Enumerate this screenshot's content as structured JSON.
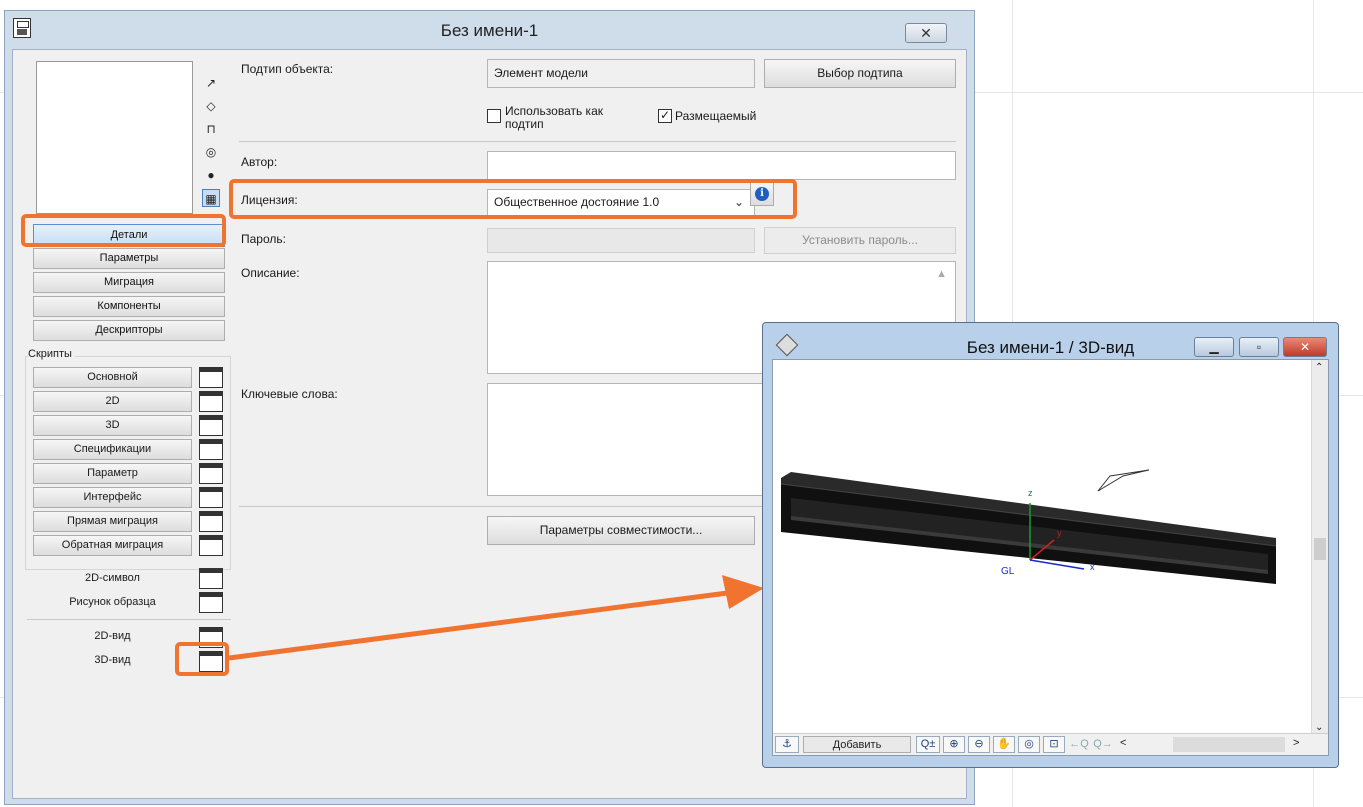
{
  "main_window": {
    "title": "Без имени-1",
    "close_label": "✕"
  },
  "view_icons": [
    "↗",
    "◇",
    "⊓",
    "◎",
    "●",
    "▦"
  ],
  "nav": {
    "details": "Детали",
    "parameters": "Параметры",
    "migration": "Миграция",
    "components": "Компоненты",
    "descriptors": "Дескрипторы"
  },
  "scripts": {
    "group_label": "Скрипты",
    "items": [
      "Основной",
      "2D",
      "3D",
      "Спецификации",
      "Параметр",
      "Интерфейс",
      "Прямая миграция",
      "Обратная миграция"
    ]
  },
  "symbols": {
    "items": [
      "2D-символ",
      "Рисунок образца"
    ],
    "views": [
      "2D-вид",
      "3D-вид"
    ]
  },
  "form": {
    "subtype_label": "Подтип объекта:",
    "subtype_value": "Элемент модели",
    "choose_subtype": "Выбор подтипа",
    "use_as_subtype": "Использовать как подтип",
    "use_as_subtype_checked": false,
    "placeable": "Размещаемый",
    "placeable_checked": true,
    "author_label": "Автор:",
    "author_value": "",
    "license_label": "Лицензия:",
    "license_value": "Общественное достояние 1.0",
    "password_label": "Пароль:",
    "set_password": "Установить пароль...",
    "description_label": "Описание:",
    "keywords_label": "Ключевые слова:",
    "compat_button": "Параметры совместимости..."
  },
  "view3d": {
    "title": "Без имени-1 / 3D-вид",
    "axis_z": "z",
    "axis_y": "y",
    "axis_x": "x",
    "gl_label": "GL",
    "add_button": "Добавить",
    "minimize": "▁",
    "maximize": "▫",
    "close": "✕"
  },
  "colors": {
    "highlight": "#f07330"
  }
}
